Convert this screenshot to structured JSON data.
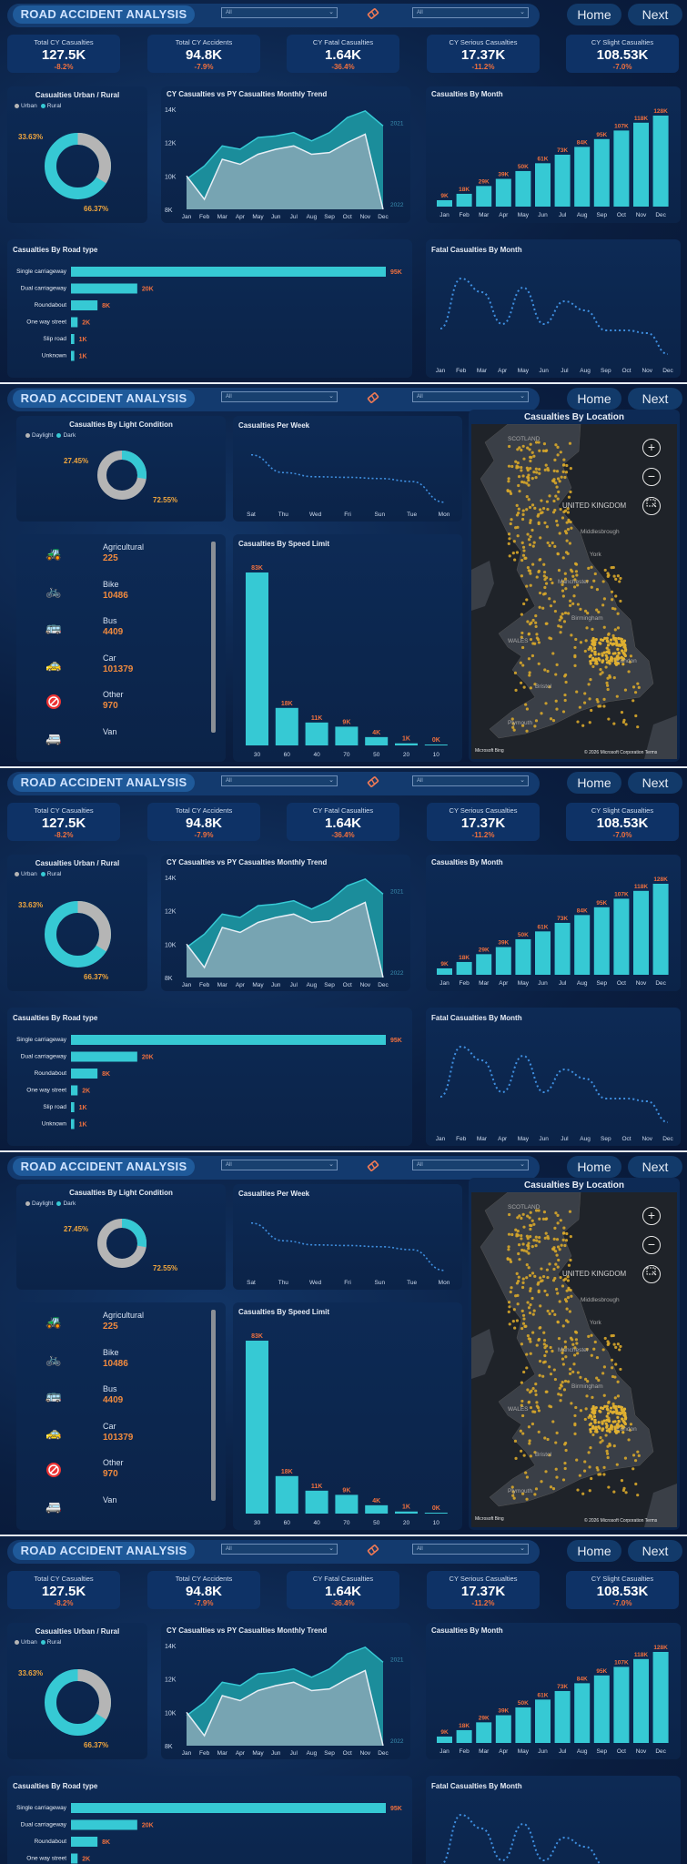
{
  "header": {
    "title": "ROAD ACCIDENT ANALYSIS",
    "slicer1_value": "All",
    "slicer2_value": "All",
    "eraser_icon": "eraser-icon",
    "home_label": "Home",
    "next_label": "Next"
  },
  "kpis": [
    {
      "label": "Total CY Casualties",
      "value": "127.5K",
      "change": "-8.2%"
    },
    {
      "label": "Total CY Accidents",
      "value": "94.8K",
      "change": "-7.9%"
    },
    {
      "label": "CY Fatal Casualties",
      "value": "1.64K",
      "change": "-36.4%"
    },
    {
      "label": "CY Serious Casualties",
      "value": "17.37K",
      "change": "-11.2%"
    },
    {
      "label": "CY Slight Casualties",
      "value": "108.53K",
      "change": "-7.0%"
    }
  ],
  "urban_rural": {
    "title": "Casualties Urban / Rural",
    "legend": [
      "Urban",
      "Rural"
    ],
    "urban_pct": "33.63%",
    "rural_pct": "66.37%",
    "urban_fraction": 0.3363
  },
  "trend": {
    "title": "CY Casualties vs PY Casualties Monthly Trend",
    "yticks": [
      "14K",
      "12K",
      "10K",
      "8K"
    ],
    "months": [
      "Jan",
      "Feb",
      "Mar",
      "Apr",
      "May",
      "Jun",
      "Jul",
      "Aug",
      "Sep",
      "Oct",
      "Nov",
      "Dec"
    ],
    "cy": [
      10.0,
      8.6,
      11.0,
      10.7,
      11.3,
      11.6,
      11.8,
      11.3,
      11.4,
      12.0,
      12.5,
      8.0
    ],
    "py": [
      9.8,
      10.6,
      11.8,
      11.6,
      12.3,
      12.4,
      12.6,
      12.1,
      12.6,
      13.5,
      13.9,
      13.0
    ],
    "py_label": "2021",
    "cy_label": "2022",
    "ymin": 8,
    "ymax": 14
  },
  "by_month": {
    "title": "Casualties By Month",
    "months": [
      "Jan",
      "Feb",
      "Mar",
      "Apr",
      "May",
      "Jun",
      "Jul",
      "Aug",
      "Sep",
      "Oct",
      "Nov",
      "Dec"
    ],
    "labels": [
      "9K",
      "18K",
      "29K",
      "39K",
      "50K",
      "61K",
      "73K",
      "84K",
      "95K",
      "107K",
      "118K",
      "128K"
    ],
    "values": [
      9,
      18,
      29,
      39,
      50,
      61,
      73,
      84,
      95,
      107,
      118,
      128
    ]
  },
  "road_type": {
    "title": "Casualties By Road type",
    "categories": [
      "Single carriageway",
      "Dual carriageway",
      "Roundabout",
      "One way street",
      "Slip road",
      "Unknown"
    ],
    "labels": [
      "95K",
      "20K",
      "8K",
      "2K",
      "1K",
      "1K"
    ],
    "values": [
      95,
      20,
      8,
      2,
      1,
      1
    ]
  },
  "fatal_month": {
    "title": "Fatal Casualties By Month",
    "months": [
      "Jan",
      "Feb",
      "Mar",
      "Apr",
      "May",
      "Jun",
      "Jul",
      "Aug",
      "Sep",
      "Oct",
      "Nov",
      "Dec"
    ],
    "values": [
      0.3,
      0.85,
      0.7,
      0.35,
      0.75,
      0.35,
      0.6,
      0.5,
      0.28,
      0.28,
      0.25,
      0.02
    ]
  },
  "light": {
    "title": "Casualties By Light Condition",
    "legend": [
      "Daylight",
      "Dark"
    ],
    "dark_pct": "27.45%",
    "day_pct": "72.55%",
    "dark_fraction": 0.2745
  },
  "per_week": {
    "title": "Casualties Per Week",
    "days": [
      "Sat",
      "Thu",
      "Wed",
      "Fri",
      "Sun",
      "Tue",
      "Mon"
    ],
    "values": [
      0.85,
      0.55,
      0.48,
      0.47,
      0.45,
      0.4,
      0.05
    ]
  },
  "vehicles": [
    {
      "name": "Agricultural",
      "value": "225",
      "icon": "tractor-icon",
      "glyph": "🚜"
    },
    {
      "name": "Bike",
      "value": "10486",
      "icon": "bike-icon",
      "glyph": "🚲"
    },
    {
      "name": "Bus",
      "value": "4409",
      "icon": "bus-icon",
      "glyph": "🚌"
    },
    {
      "name": "Car",
      "value": "101379",
      "icon": "car-icon",
      "glyph": "🚕"
    },
    {
      "name": "Other",
      "value": "970",
      "icon": "no-entry-icon",
      "glyph": "⊘"
    },
    {
      "name": "Van",
      "value": "",
      "icon": "van-icon",
      "glyph": "🚐"
    }
  ],
  "speed": {
    "title": "Casualties By Speed Limit",
    "categories": [
      "30",
      "60",
      "40",
      "70",
      "50",
      "20",
      "10"
    ],
    "labels": [
      "83K",
      "18K",
      "11K",
      "9K",
      "4K",
      "1K",
      "0K"
    ],
    "values": [
      83,
      18,
      11,
      9,
      4,
      1,
      0.2
    ]
  },
  "map": {
    "title": "Casualties By Location",
    "place_labels": [
      "SCOTLAND",
      "UNITED KINGDOM",
      "Middlesbrough",
      "York",
      "Manchester",
      "Birmingham",
      "WALES",
      "Bristol",
      "London",
      "Plymouth"
    ],
    "attribution": "© 2026 Microsoft Corporation  Terms",
    "brand": "Microsoft Bing",
    "zoom_in": "+",
    "zoom_out": "−"
  },
  "colors": {
    "accent": "#36c9d4",
    "orange": "#f0703e",
    "grey": "#b5b5b5",
    "dashed": "#3f8fe0"
  }
}
